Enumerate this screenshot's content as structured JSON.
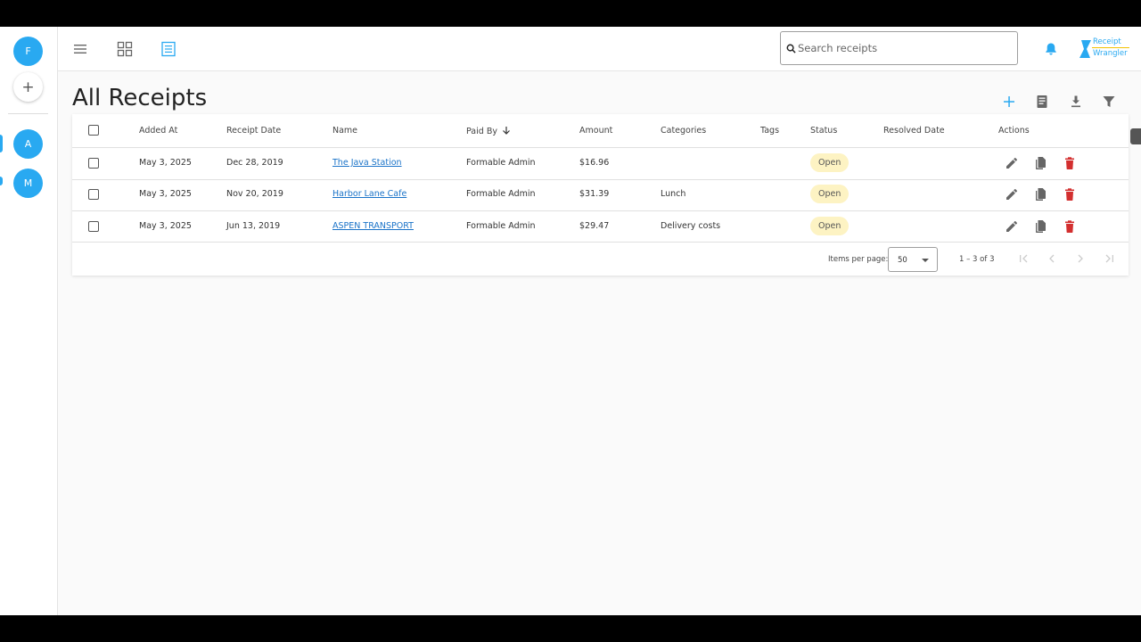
{
  "rail": {
    "groups": [
      {
        "initial": "F"
      },
      {
        "initial": "A"
      },
      {
        "initial": "M"
      }
    ],
    "add_label": "+"
  },
  "topbar": {
    "search_placeholder": "Search receipts",
    "logo_line1": "Receipt",
    "logo_line2": "Wrangler"
  },
  "page": {
    "title": "All Receipts"
  },
  "table": {
    "columns": [
      "Added At",
      "Receipt Date",
      "Name",
      "Paid By",
      "Amount",
      "Categories",
      "Tags",
      "Status",
      "Resolved Date",
      "Actions"
    ],
    "sort_column": "Paid By",
    "sort_direction": "descending",
    "rows": [
      {
        "added_at": "May 3, 2025",
        "receipt_date": "Dec 28, 2019",
        "name": "The Java Station",
        "paid_by": "Formable Admin",
        "amount": "$16.96",
        "categories": "",
        "tags": "",
        "status": "Open",
        "resolved_date": ""
      },
      {
        "added_at": "May 3, 2025",
        "receipt_date": "Nov 20, 2019",
        "name": "Harbor Lane Cafe",
        "paid_by": "Formable Admin",
        "amount": "$31.39",
        "categories": "Lunch",
        "tags": "",
        "status": "Open",
        "resolved_date": ""
      },
      {
        "added_at": "May 3, 2025",
        "receipt_date": "Jun 13, 2019",
        "name": "ASPEN TRANSPORT",
        "paid_by": "Formable Admin",
        "amount": "$29.47",
        "categories": "Delivery costs",
        "tags": "",
        "status": "Open",
        "resolved_date": ""
      }
    ]
  },
  "paginator": {
    "items_per_page_label": "Items per page:",
    "items_per_page_value": "50",
    "range_label": "1 – 3 of 3"
  },
  "colors": {
    "accent": "#29a9f1",
    "status_open_bg": "#fdf3c3",
    "delete": "#d32f2f",
    "link": "#1a73c8"
  }
}
